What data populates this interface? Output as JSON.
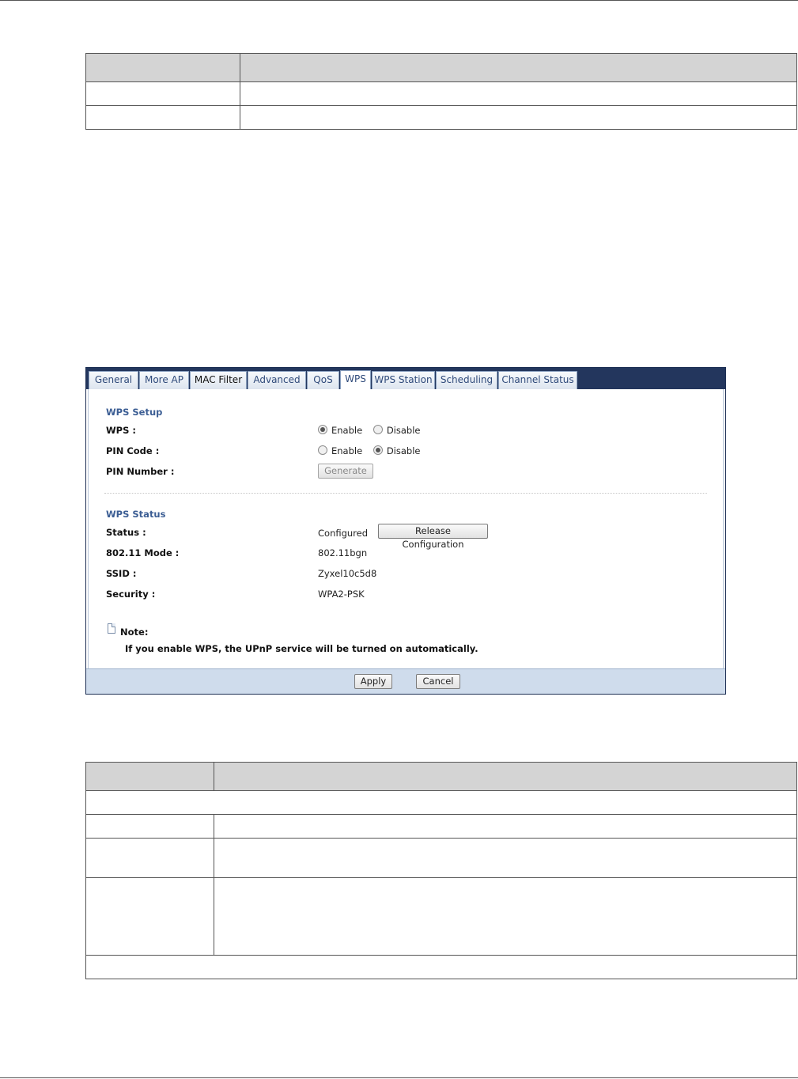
{
  "tabs": [
    {
      "label": "General"
    },
    {
      "label": "More AP"
    },
    {
      "label": "MAC Filter"
    },
    {
      "label": "Advanced"
    },
    {
      "label": "QoS"
    },
    {
      "label": "WPS"
    },
    {
      "label": "WPS Station"
    },
    {
      "label": "Scheduling"
    },
    {
      "label": "Channel Status"
    }
  ],
  "active_tab": "WPS",
  "wps_setup": {
    "title": "WPS Setup",
    "wps_label": "WPS :",
    "wps_enable": "Enable",
    "wps_disable": "Disable",
    "wps_selected": "Enable",
    "pin_code_label": "PIN Code :",
    "pin_enable": "Enable",
    "pin_disable": "Disable",
    "pin_selected": "Disable",
    "pin_number_label": "PIN Number :",
    "generate_button": "Generate"
  },
  "wps_status": {
    "title": "WPS Status",
    "status_label": "Status :",
    "status_value": "Configured",
    "release_button": "Release Configuration",
    "mode_label": "802.11 Mode :",
    "mode_value": "802.11bgn",
    "ssid_label": "SSID :",
    "ssid_value": "Zyxel10c5d8",
    "security_label": "Security :",
    "security_value": "WPA2-PSK"
  },
  "note": {
    "title": "Note:",
    "text": "If you enable WPS, the UPnP service will be turned on automatically."
  },
  "footer": {
    "apply": "Apply",
    "cancel": "Cancel"
  },
  "colors": {
    "tabbar": "#23365d",
    "section_title": "#3c5e94",
    "footer": "#cfdcec"
  }
}
